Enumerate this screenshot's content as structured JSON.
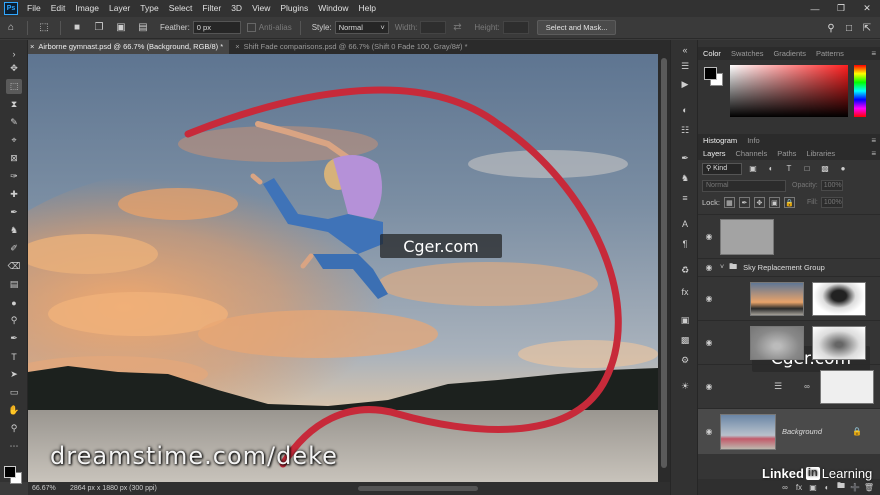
{
  "menu": [
    "File",
    "Edit",
    "Image",
    "Layer",
    "Type",
    "Select",
    "Filter",
    "3D",
    "View",
    "Plugins",
    "Window",
    "Help"
  ],
  "app_logo_text": "Ps",
  "options": {
    "feather_label": "Feather:",
    "feather_value": "0 px",
    "antialias_label": "Anti-alias",
    "style_label": "Style:",
    "style_value": "Normal",
    "width_label": "Width:",
    "height_label": "Height:",
    "select_mask": "Select and Mask..."
  },
  "tabs": [
    {
      "label": "Airborne gymnast.psd @ 66.7% (Background, RGB/8) *",
      "active": true
    },
    {
      "label": "Shift Fade comparisons.psd @ 66.7% (Shift 0 Fade 100, Gray/8#) *",
      "active": false
    }
  ],
  "status": {
    "zoom": "66.67%",
    "doc_info": "2864 px x 1880 px (300 ppi)"
  },
  "color_panel": {
    "tabs": [
      "Color",
      "Swatches",
      "Gradients",
      "Patterns"
    ]
  },
  "histogram_tabs": [
    "Histogram",
    "Info"
  ],
  "layers_panel": {
    "tabs": [
      "Layers",
      "Channels",
      "Paths",
      "Libraries"
    ],
    "kind": "Kind",
    "blend": "Normal",
    "opacity_label": "Opacity:",
    "opacity_value": "100%",
    "lock_label": "Lock:",
    "fill_label": "Fill:",
    "fill_value": "100%",
    "group_name": "Sky Replacement Group",
    "background_name": "Background"
  },
  "watermarks": {
    "cger": "Cger.com",
    "dreamstime": "dreamstime.com/deke",
    "linkedin_a": "Linked",
    "linkedin_b": "in",
    "linkedin_c": "Learning"
  }
}
